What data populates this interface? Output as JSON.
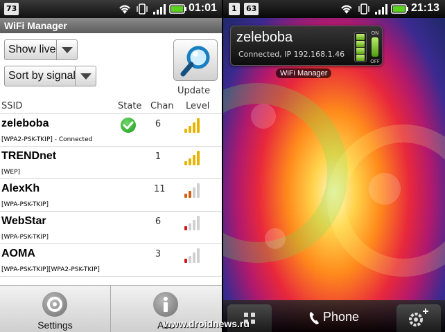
{
  "left_status_bar": {
    "notification_count": "73",
    "time": "01:01"
  },
  "app": {
    "title": "WiFi Manager"
  },
  "controls": {
    "filter_spinner": "Show live",
    "sort_spinner": "Sort by signal",
    "update_label": "Update"
  },
  "table": {
    "headers": {
      "ssid": "SSID",
      "state": "State",
      "chan": "Chan",
      "level": "Level"
    },
    "rows": [
      {
        "ssid": "zeleboba",
        "security": "[WPA2-PSK-TKIP] - Connected",
        "chan": "6",
        "state": "connected",
        "level_bars": 4,
        "level_color": "#e8b400"
      },
      {
        "ssid": "TRENDnet",
        "security": "[WEP]",
        "chan": "1",
        "state": "",
        "level_bars": 4,
        "level_color": "#e8b400"
      },
      {
        "ssid": "AlexKh",
        "security": "[WPA-PSK-TKIP]",
        "chan": "11",
        "state": "",
        "level_bars": 2,
        "level_color": "#d06010"
      },
      {
        "ssid": "WebStar",
        "security": "[WPA-PSK-TKIP]",
        "chan": "6",
        "state": "",
        "level_bars": 1,
        "level_color": "#d01818"
      },
      {
        "ssid": "AOMA",
        "security": "[WPA-PSK-TKIP][WPA2-PSK-TKIP]",
        "chan": "3",
        "state": "",
        "level_bars": 1,
        "level_color": "#d01818"
      }
    ]
  },
  "bottom_menu": {
    "settings_label": "Settings",
    "about_label": "Abo"
  },
  "right_status_bar": {
    "calendar_day": "1",
    "notification_count": "63",
    "time": "21:13"
  },
  "widget": {
    "ssid": "zeleboba",
    "status": "Connected, IP 192.168.1.46",
    "on_label": "ON",
    "off_label": "OFF",
    "caption": "WiFi Manager"
  },
  "dock": {
    "phone_label": "Phone"
  },
  "watermark": "www.droidnews.ru",
  "colors": {
    "connected_green": "#1b9a1b",
    "widget_green": "#7bc828",
    "bar_inactive": "#d0d0d0"
  }
}
